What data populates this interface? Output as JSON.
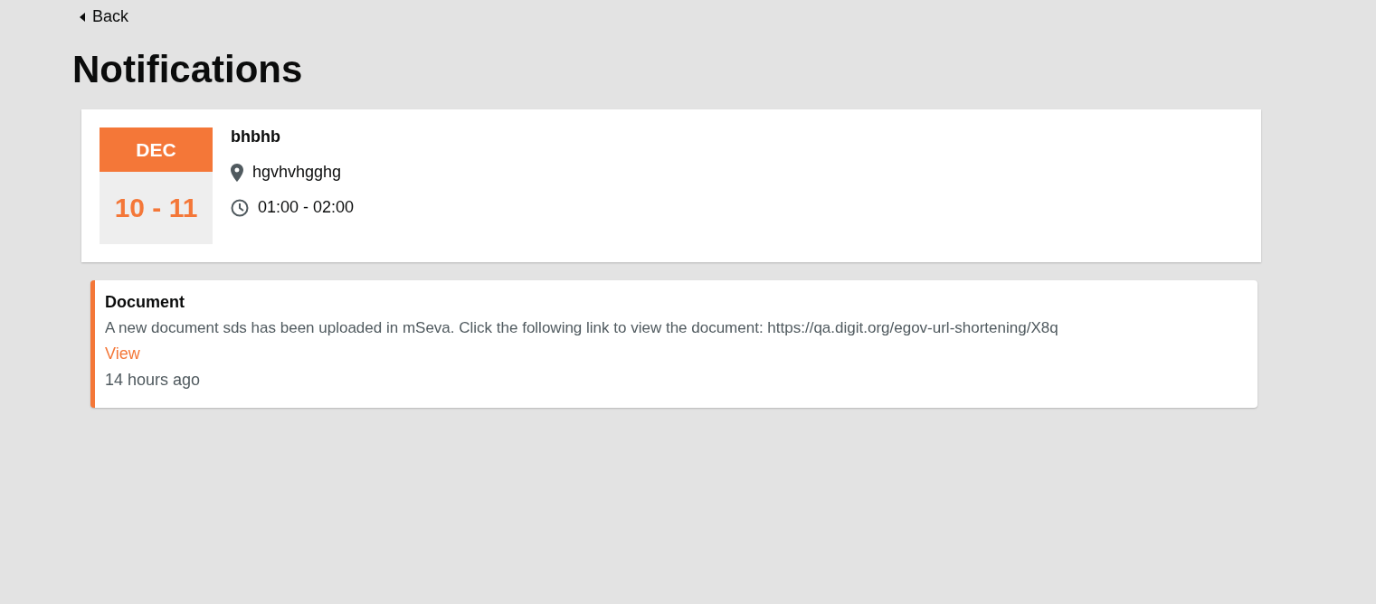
{
  "back": {
    "label": "Back"
  },
  "title": "Notifications",
  "event": {
    "month": "DEC",
    "dates": "10 - 11",
    "name": "bhbhb",
    "location": "hgvhvhgghg",
    "time": "01:00 - 02:00"
  },
  "notifications": [
    {
      "title": "Document",
      "message": "A new document sds has been uploaded in mSeva. Click the following link to view the document: https://qa.digit.org/egov-url-shortening/X8q",
      "link": "View",
      "time": "14 hours ago"
    }
  ]
}
